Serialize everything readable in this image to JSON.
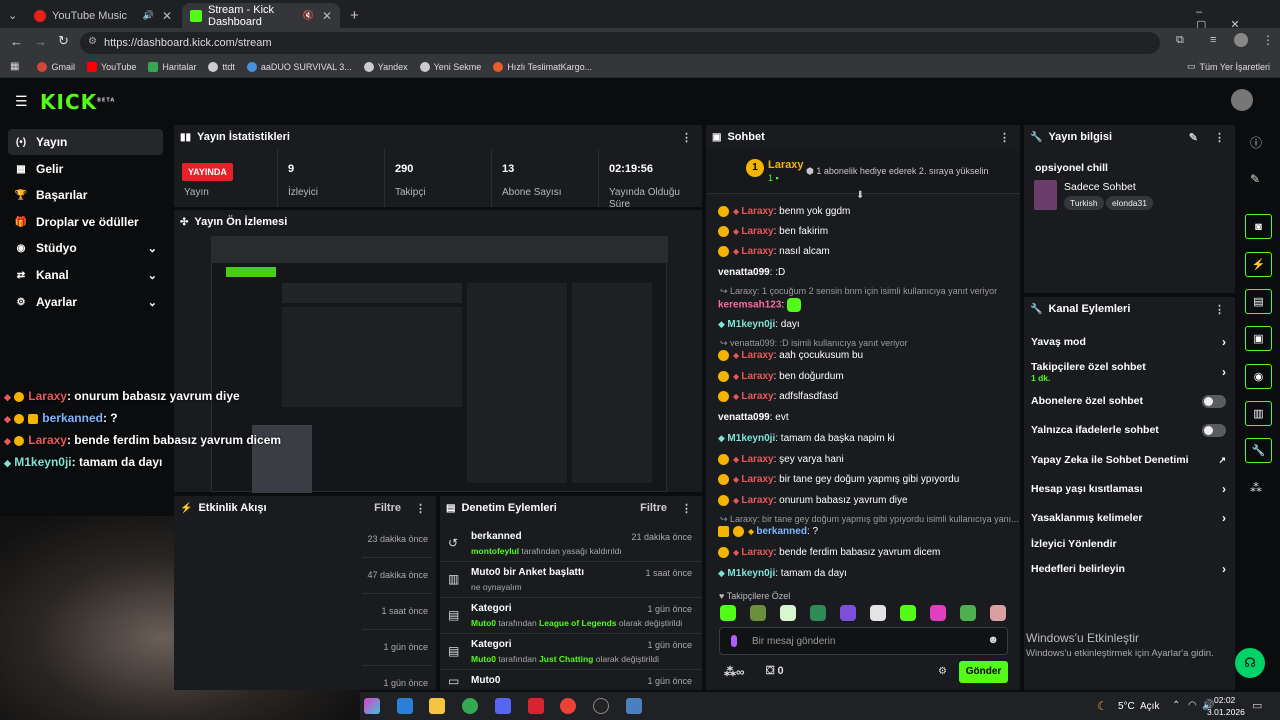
{
  "browser": {
    "tabs": [
      {
        "title": "YouTube Music",
        "active": false
      },
      {
        "title": "Stream - Kick Dashboard",
        "active": true
      }
    ],
    "new_tab": "+",
    "url": "https://dashboard.kick.com/stream",
    "bookmarks": [
      "Gmail",
      "YouTube",
      "Haritalar",
      "ttdt",
      "aaDUO SURVIVAL 3...",
      "Yandex",
      "Yeni Sekme",
      "Hızlı TeslimatKargo..."
    ],
    "bookmarks_all": "Tüm Yer İşaretleri"
  },
  "kick": {
    "logo": "KICK",
    "beta": "BETA"
  },
  "sidebar": {
    "items": [
      {
        "label": "Yayın",
        "icon": "(•)"
      },
      {
        "label": "Gelir",
        "icon": "▦"
      },
      {
        "label": "Başarılar",
        "icon": "🏆"
      },
      {
        "label": "Droplar ve ödüller",
        "icon": "🎁"
      },
      {
        "label": "Stüdyo",
        "icon": "◉"
      },
      {
        "label": "Kanal",
        "icon": "⇄"
      },
      {
        "label": "Ayarlar",
        "icon": "⚙"
      }
    ]
  },
  "stats": {
    "title": "Yayın İstatistikleri",
    "live_badge": "YAYINDA",
    "live_label": "Yayın",
    "viewers": {
      "value": "9",
      "label": "İzleyici"
    },
    "followers": {
      "value": "290",
      "label": "Takipçi"
    },
    "subs": {
      "value": "13",
      "label": "Abone Sayısı"
    },
    "uptime": {
      "value": "02:19:56",
      "label": "Yayında Olduğu Süre"
    }
  },
  "preview": {
    "title": "Yayın Ön İzlemesi"
  },
  "overlay_chat": [
    {
      "user": "Laraxy",
      "msg": ": onurum babasız yavrum diye",
      "color": "#e8585a"
    },
    {
      "user": "berkanned",
      "msg": ": ?",
      "color": "#7eb6ff"
    },
    {
      "user": "Laraxy",
      "msg": ": bende ferdim babasız yavrum dicem",
      "color": "#e8585a"
    },
    {
      "user": "M1keyn0ji",
      "msg": ": tamam da dayı",
      "color": "#7fe3d8"
    }
  ],
  "activity": {
    "title": "Etkinlik Akışı",
    "filter": "Filtre",
    "times": [
      "23 dakika önce",
      "47 dakika önce",
      "1 saat önce",
      "1 gün önce",
      "1 gün önce"
    ]
  },
  "moderation": {
    "title": "Denetim Eylemleri",
    "filter": "Filtre",
    "items": [
      {
        "head": "berkanned",
        "user": "montofeylul",
        "rest": " tarafından yasağı kaldırıldı",
        "time": "21 dakika önce",
        "icon": "↺"
      },
      {
        "head": "Muto0 bir Anket başlattı",
        "user": "",
        "rest": "ne oynayalım",
        "time": "1 saat önce",
        "icon": "▥"
      },
      {
        "head": "Kategori",
        "user": "Muto0",
        "rest": " tarafından ",
        "hl": "League of Legends",
        "rest2": " olarak değiştirildi",
        "time": "1 gün önce",
        "icon": "▤"
      },
      {
        "head": "Kategori",
        "user": "Muto0",
        "rest": " tarafından ",
        "hl": "Just Chatting",
        "rest2": " olarak değiştirildi",
        "time": "1 gün önce",
        "icon": "▤"
      },
      {
        "head": "Muto0",
        "user": "",
        "rest": "",
        "time": "1 gün önce",
        "icon": "▭"
      }
    ]
  },
  "chat": {
    "title": "Sohbet",
    "top_user": "Laraxy",
    "top_rank": "1",
    "promo": "1 abonelik hediye ederek 2. sıraya yükselin",
    "messages": [
      {
        "user": "Laraxy",
        "text": ": benm yok ggdm",
        "color": "#e8585a"
      },
      {
        "user": "Laraxy",
        "text": ": ben fakirim",
        "color": "#e8585a"
      },
      {
        "user": "Laraxy",
        "text": ": nasıl alcam",
        "color": "#e8585a"
      },
      {
        "user": "venatta099",
        "text": ": :D",
        "color": "#ffffff"
      },
      {
        "reply": "Laraxy: 1 çocuğum 2 sensin bnm için isimli kullanıcıya yanıt veriyor"
      },
      {
        "user": "keremsah123",
        "text": ":",
        "color": "#ff6b9a"
      },
      {
        "user": "M1keyn0ji",
        "text": ": dayı",
        "color": "#7fe3d8"
      },
      {
        "reply": "venatta099: :D isimli kullanıcıya yanıt veriyor"
      },
      {
        "user": "Laraxy",
        "text": ": aah çocukusum bu",
        "color": "#e8585a"
      },
      {
        "user": "Laraxy",
        "text": ": ben doğurdum",
        "color": "#e8585a"
      },
      {
        "user": "Laraxy",
        "text": ": adfslfasdfasd",
        "color": "#e8585a"
      },
      {
        "user": "venatta099",
        "text": ": evt",
        "color": "#ffffff"
      },
      {
        "user": "M1keyn0ji",
        "text": ": tamam da başka napim ki",
        "color": "#7fe3d8"
      },
      {
        "user": "Laraxy",
        "text": ": şey varya hani",
        "color": "#e8585a"
      },
      {
        "user": "Laraxy",
        "text": ": bir tane gey doğum yapmış gibi ypıyordu",
        "color": "#e8585a"
      },
      {
        "user": "Laraxy",
        "text": ": onurum babasız yavrum diye",
        "color": "#e8585a"
      },
      {
        "reply": "Laraxy: bir tane gey doğum yapmış gibi ypıyordu isimli kullanıcıya yanı..."
      },
      {
        "user": "berkanned",
        "text": ": ?",
        "color": "#7eb6ff"
      },
      {
        "user": "Laraxy",
        "text": ": bende ferdim babasız yavrum dicem",
        "color": "#e8585a"
      },
      {
        "user": "M1keyn0ji",
        "text": ": tamam da dayı",
        "color": "#7fe3d8"
      }
    ],
    "followers_only": "Takipçilere Özel",
    "input_placeholder": "Bir mesaj gönderin",
    "points": "∞",
    "gift_count": "0",
    "send": "Gönder"
  },
  "stream_info": {
    "title": "Yayın bilgisi",
    "stream_title": "opsiyonel chill",
    "category": "Sadece Sohbet",
    "tags": [
      "Turkish",
      "elonda31"
    ]
  },
  "channel_actions": {
    "title": "Kanal Eylemleri",
    "items": [
      {
        "label": "Yavaş mod",
        "type": "chev"
      },
      {
        "label": "Takipçilere özel sohbet",
        "sub": "1 dk.",
        "type": "chev"
      },
      {
        "label": "Abonelere özel sohbet",
        "type": "toggle"
      },
      {
        "label": "Yalnızca ifadelerle sohbet",
        "type": "toggle"
      },
      {
        "label": "Yapay Zeka ile Sohbet Denetimi",
        "type": "ext"
      },
      {
        "label": "Hesap yaşı kısıtlaması",
        "type": "chev"
      },
      {
        "label": "Yasaklanmış kelimeler",
        "type": "chev"
      },
      {
        "label": "İzleyici Yönlendir",
        "type": "none"
      },
      {
        "label": "Hedefleri belirleyin",
        "type": "chev"
      }
    ]
  },
  "watermark": {
    "line1": "Windows'u Etkinleştir",
    "line2": "Windows'u etkinleştirmek için Ayarlar'a gidin."
  },
  "taskbar": {
    "weather": "5°C",
    "weather_desc": "Açık",
    "time": "02:02",
    "date": "3.01.2026"
  },
  "colors": {
    "kick_green": "#53fc18",
    "live_red": "#e8202a",
    "panel": "#191b1f"
  }
}
